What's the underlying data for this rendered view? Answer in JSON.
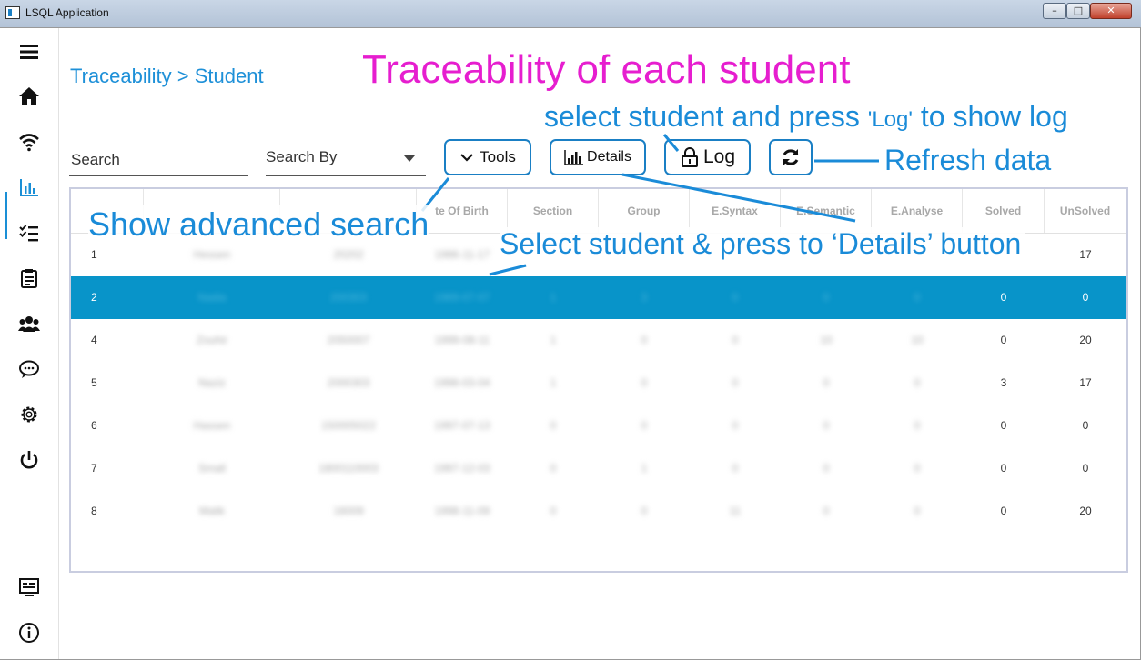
{
  "window": {
    "title": "LSQL Application",
    "min": "–",
    "max": "□",
    "close": "✕"
  },
  "breadcrumb": "Traceability > Student",
  "search": {
    "placeholder": "Search"
  },
  "search_by": {
    "label": "Search By"
  },
  "buttons": {
    "tools": "Tools",
    "details": "Details",
    "log": "Log"
  },
  "table": {
    "headers": [
      "",
      "",
      "",
      "te Of Birth",
      "Section",
      "Group",
      "E.Syntax",
      "E.Semantic",
      "E.Analyse",
      "Solved",
      "UnSolved"
    ],
    "rows": [
      {
        "id": "1",
        "a": "Hessen",
        "b": "20202",
        "c": "1986-11-17",
        "d": "",
        "e": "",
        "f": "",
        "g": "",
        "h": "",
        "solved": "",
        "unsolved": "17"
      },
      {
        "id": "2",
        "a": "Nadia",
        "b": "200303",
        "c": "1989-07-07",
        "d": "1",
        "e": "3",
        "f": "0",
        "g": "0",
        "h": "0",
        "solved": "0",
        "unsolved": "0"
      },
      {
        "id": "4",
        "a": "Zouhir",
        "b": "2050007",
        "c": "1999-08-11",
        "d": "1",
        "e": "0",
        "f": "0",
        "g": "10",
        "h": "10",
        "solved": "0",
        "unsolved": "20"
      },
      {
        "id": "5",
        "a": "Naziz",
        "b": "2000303",
        "c": "1998-03-04",
        "d": "1",
        "e": "0",
        "f": "0",
        "g": "0",
        "h": "0",
        "solved": "3",
        "unsolved": "17"
      },
      {
        "id": "6",
        "a": "Hassen",
        "b": "150005022",
        "c": "1997-07-13",
        "d": "0",
        "e": "0",
        "f": "0",
        "g": "0",
        "h": "0",
        "solved": "0",
        "unsolved": "0"
      },
      {
        "id": "7",
        "a": "Small",
        "b": "1800110003",
        "c": "1997-12-03",
        "d": "0",
        "e": "1",
        "f": "0",
        "g": "0",
        "h": "0",
        "solved": "0",
        "unsolved": "0"
      },
      {
        "id": "8",
        "a": "Malik",
        "b": "16009",
        "c": "1998-11-09",
        "d": "0",
        "e": "0",
        "f": "11",
        "g": "0",
        "h": "0",
        "solved": "0",
        "unsolved": "20"
      }
    ],
    "selected_index": 1
  },
  "annotations": {
    "title": "Traceability of each student",
    "log_part1": "select student and press ",
    "log_quote": "'Log'",
    "log_part2": "  to show log",
    "refresh": "Refresh data",
    "tools": "Show advanced search",
    "details": "Select student & press to ‘Details’ button"
  },
  "colors": {
    "accent": "#1a8fd6",
    "selected_row": "#0894c9",
    "annotation_pink": "#e61ecf"
  }
}
